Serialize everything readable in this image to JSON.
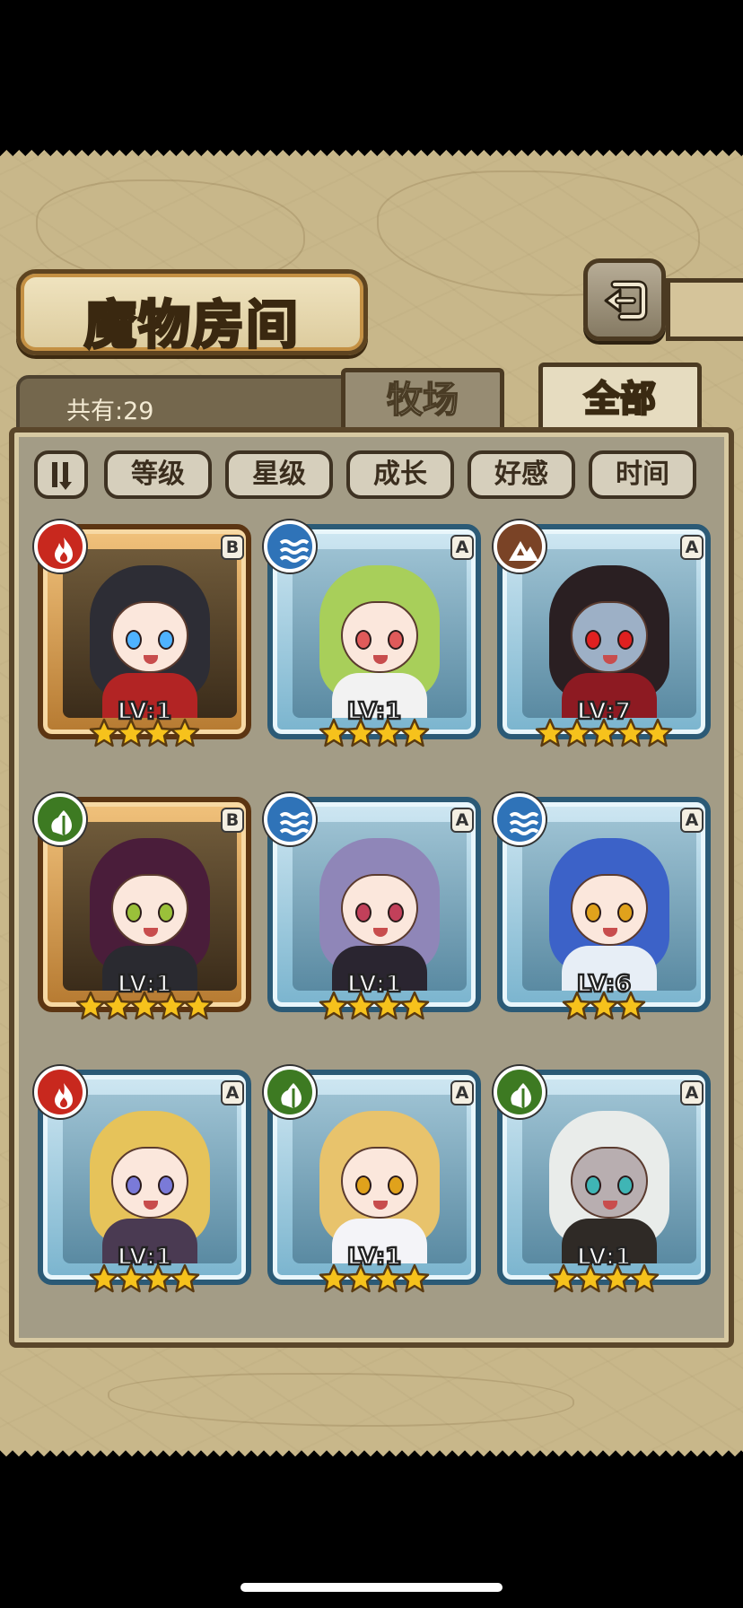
{
  "screen": {
    "title": "魔物房间",
    "count_text": "共有:29"
  },
  "tabs": {
    "farm": "牧场",
    "all": "全部"
  },
  "sort": {
    "order_icon": "sort-order-icon",
    "buttons": [
      "等级",
      "星级",
      "成长",
      "好感",
      "时间"
    ]
  },
  "colors": {
    "fire": "#c8281e",
    "water": "#2f73b8",
    "earth": "#7a4326",
    "nature": "#3d7a22",
    "star": "#f6c21c"
  },
  "monsters": [
    {
      "rank": "B",
      "element": "fire",
      "level": "LV:1",
      "stars": 4,
      "hair": "#2d2d35",
      "outfit": "#b22424",
      "eye": "#4fb2ff",
      "face": ""
    },
    {
      "rank": "A",
      "element": "water",
      "level": "LV:1",
      "stars": 4,
      "hair": "#a8cf5a",
      "outfit": "#f2f2f2",
      "eye": "#e05a5a",
      "face": ""
    },
    {
      "rank": "A",
      "element": "earth",
      "level": "LV:7",
      "stars": 5,
      "hair": "#2a1f22",
      "outfit": "#8d1a22",
      "eye": "#e02020",
      "face": "dark"
    },
    {
      "rank": "B",
      "element": "nature",
      "level": "LV:1",
      "stars": 5,
      "hair": "#4a1d3a",
      "outfit": "#2a2a30",
      "eye": "#9ac03a",
      "face": ""
    },
    {
      "rank": "A",
      "element": "water",
      "level": "LV:1",
      "stars": 4,
      "hair": "#8f86b8",
      "outfit": "#2a2530",
      "eye": "#c2405a",
      "face": ""
    },
    {
      "rank": "A",
      "element": "water",
      "level": "LV:6",
      "stars": 3,
      "hair": "#3c62c8",
      "outfit": "#e7eef6",
      "eye": "#e0a21c",
      "face": ""
    },
    {
      "rank": "A",
      "element": "fire",
      "level": "LV:1",
      "stars": 4,
      "hair": "#e6c35a",
      "outfit": "#4a3a52",
      "eye": "#7a7ad8",
      "face": ""
    },
    {
      "rank": "A",
      "element": "nature",
      "level": "LV:1",
      "stars": 4,
      "hair": "#e8c36c",
      "outfit": "#f4f4f8",
      "eye": "#e0a21c",
      "face": ""
    },
    {
      "rank": "A",
      "element": "nature",
      "level": "LV:1",
      "stars": 4,
      "hair": "#e9ecea",
      "outfit": "#2f2a26",
      "eye": "#3fb5b5",
      "face": "grey"
    }
  ]
}
